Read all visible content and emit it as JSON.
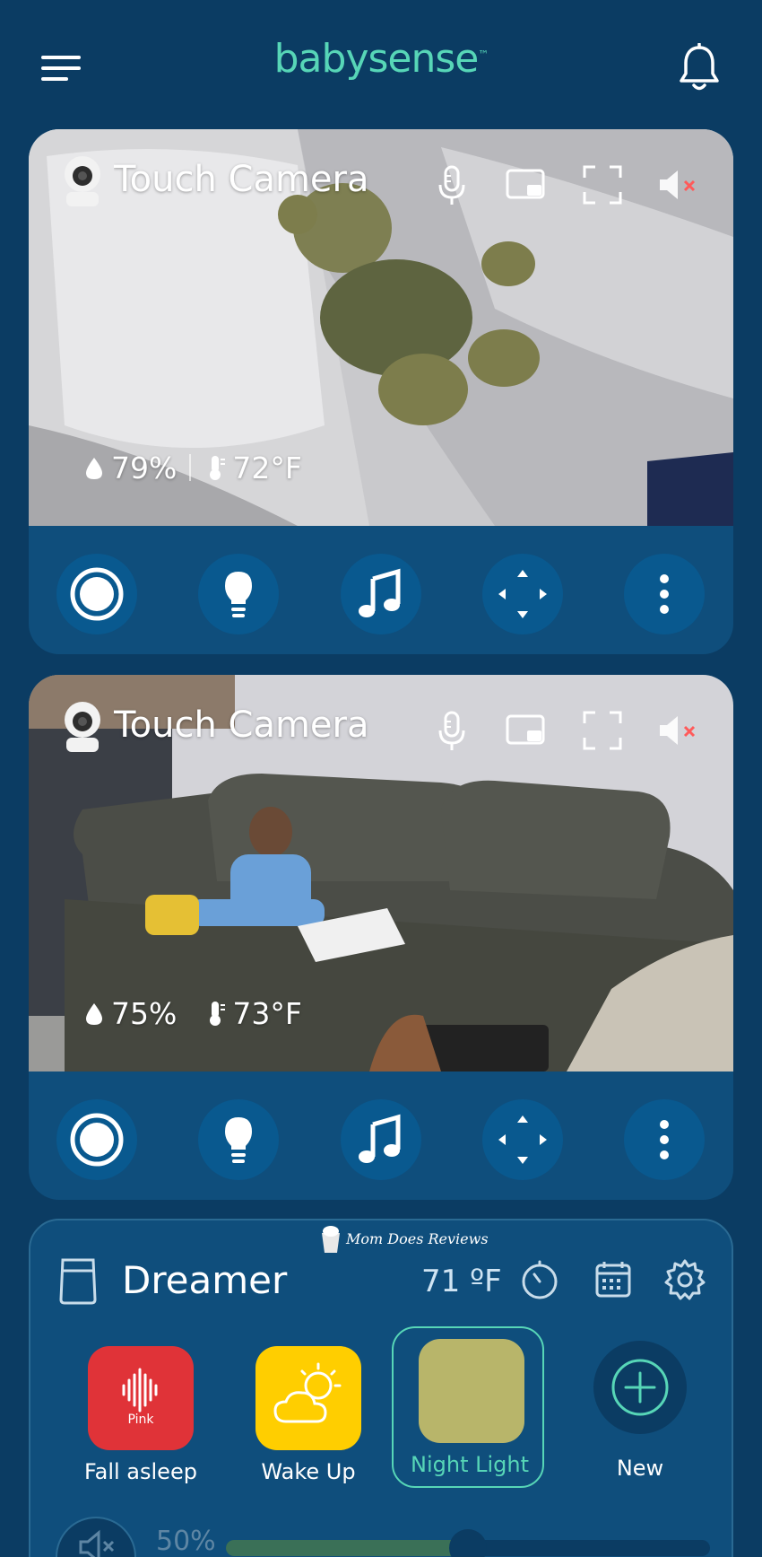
{
  "app": {
    "logo_text": "babysense",
    "logo_tm": "™"
  },
  "cameras": [
    {
      "name": "Touch Camera",
      "humidity": "79%",
      "temperature": "72°F"
    },
    {
      "name": "Touch Camera",
      "humidity": "75%",
      "temperature": "73°F"
    }
  ],
  "camera_controls": [
    "record-icon",
    "light-bulb-icon",
    "music-icon",
    "pan-tilt-icon",
    "more-icon"
  ],
  "dreamer": {
    "title": "Dreamer",
    "temperature": "71 ºF",
    "watermark": "Mom Does Reviews",
    "presets": [
      {
        "label": "Fall asleep",
        "tag": "Pink",
        "color": "#e03338"
      },
      {
        "label": "Wake Up",
        "color": "#ffce00"
      },
      {
        "label": "Night Light",
        "color": "#b8b56a",
        "active": true
      }
    ],
    "new_label": "New",
    "volume": {
      "value": "50%",
      "fraction": 0.5
    }
  },
  "colors": {
    "background": "#0b3c63",
    "card": "#0f4e7c",
    "accent": "#57d6b7",
    "muted_red": "#ff5a5a"
  }
}
